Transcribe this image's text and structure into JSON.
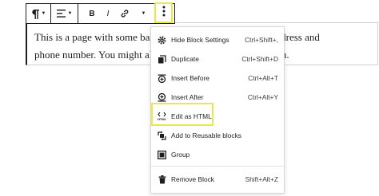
{
  "paragraph": {
    "line1": "This is a page with some basic",
    "line1_end": "address and",
    "line2": "phone number. You might also",
    "line2_end": "n."
  },
  "toolbar": {
    "italic_label": "I",
    "bold_label": "B"
  },
  "menu": {
    "items": [
      {
        "label": "Hide Block Settings",
        "shortcut": "Ctrl+Shift+,",
        "icon": "gear-icon"
      },
      {
        "label": "Duplicate",
        "shortcut": "Ctrl+Shift+D",
        "icon": "duplicate-icon"
      },
      {
        "label": "Insert Before",
        "shortcut": "Ctrl+Alt+T",
        "icon": "insert-before-icon"
      },
      {
        "label": "Insert After",
        "shortcut": "Ctrl+Alt+Y",
        "icon": "insert-after-icon"
      },
      {
        "label": "Edit as HTML",
        "shortcut": "",
        "icon": "html-icon",
        "icon_text": "HTML"
      },
      {
        "label": "Add to Reusable blocks",
        "shortcut": "",
        "icon": "reusable-block-icon"
      },
      {
        "label": "Group",
        "shortcut": "",
        "icon": "group-icon"
      },
      {
        "label": "Remove Block",
        "shortcut": "Shift+Alt+Z",
        "icon": "trash-icon"
      }
    ]
  },
  "colors": {
    "highlight": "#e8e846",
    "text": "#1e1e1e"
  }
}
